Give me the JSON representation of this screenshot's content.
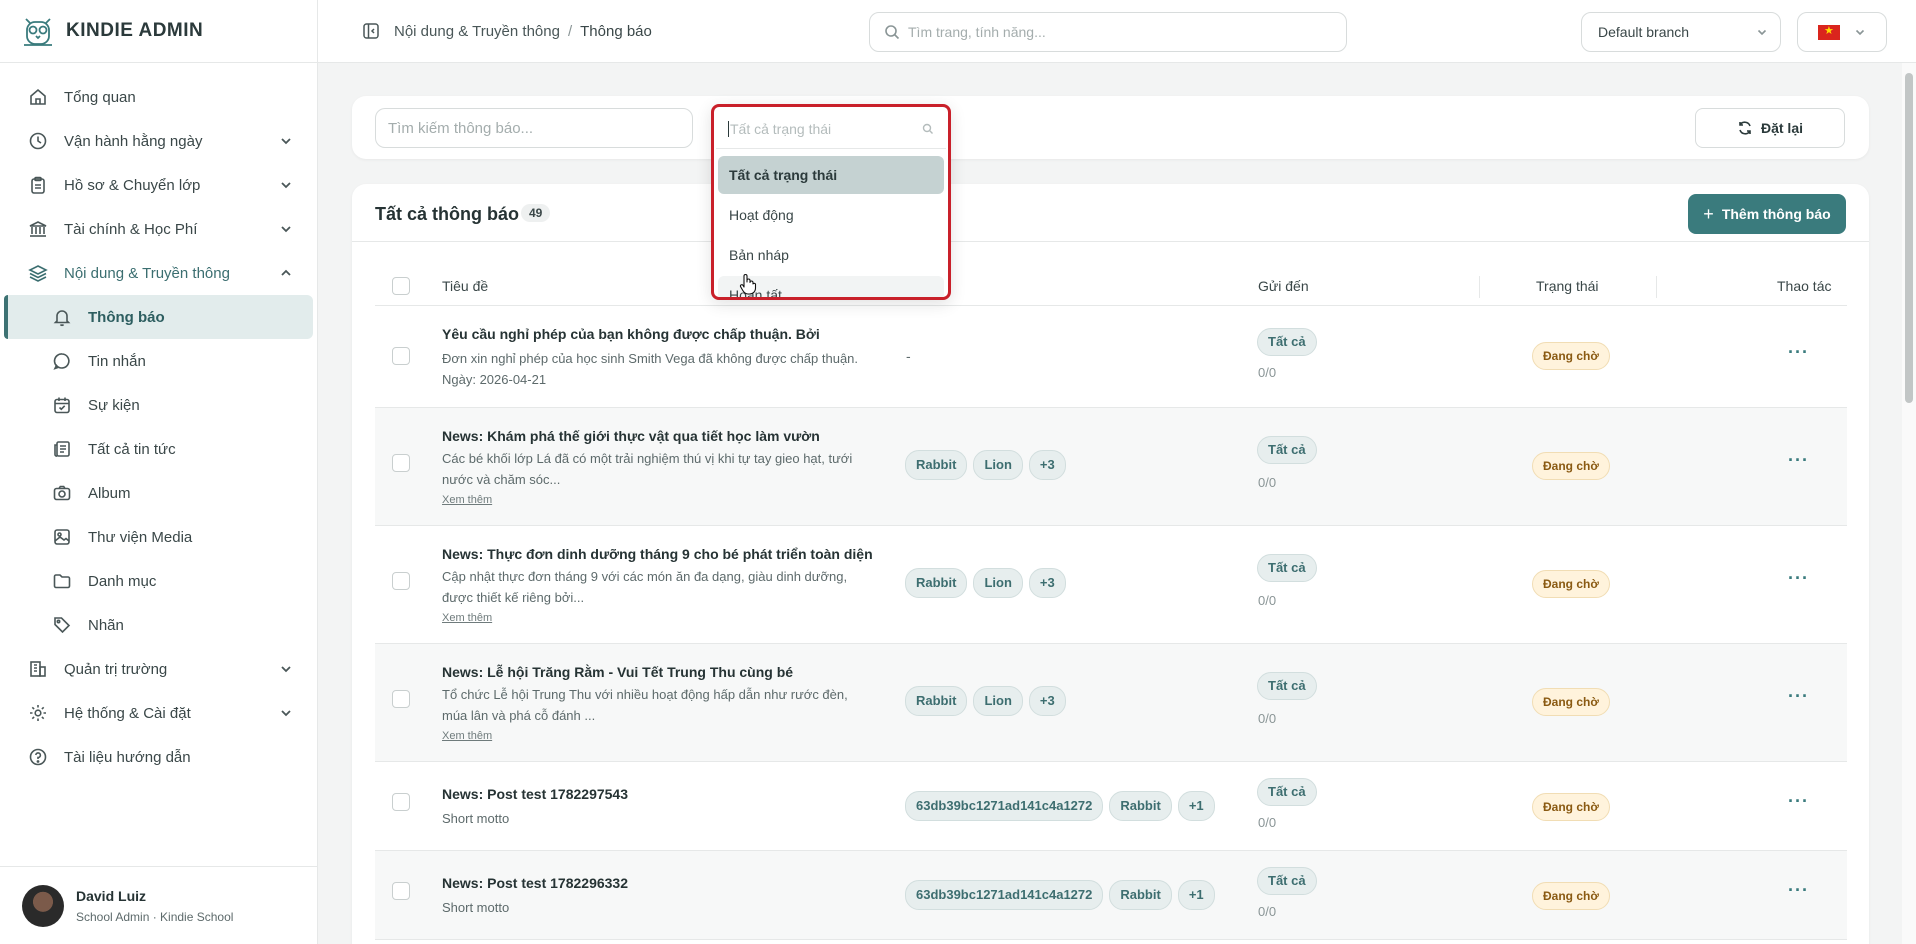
{
  "app": {
    "name": "KINDIE ADMIN"
  },
  "sidebar": {
    "items": [
      {
        "label": "Tổng quan",
        "icon": "home-icon",
        "expandable": false
      },
      {
        "label": "Vận hành hằng ngày",
        "icon": "clock-icon",
        "expandable": true
      },
      {
        "label": "Hồ sơ & Chuyển lớp",
        "icon": "clipboard-icon",
        "expandable": true
      },
      {
        "label": "Tài chính & Học Phí",
        "icon": "bank-icon",
        "expandable": true
      },
      {
        "label": "Nội dung & Truyền thông",
        "icon": "layers-icon",
        "expandable": true,
        "open": true
      }
    ],
    "sub_items": [
      {
        "label": "Thông báo",
        "icon": "bell-icon",
        "active": true
      },
      {
        "label": "Tin nhắn",
        "icon": "message-icon"
      },
      {
        "label": "Sự kiện",
        "icon": "calendar-icon"
      },
      {
        "label": "Tất cả tin tức",
        "icon": "newspaper-icon"
      },
      {
        "label": "Album",
        "icon": "camera-icon"
      },
      {
        "label": "Thư viện Media",
        "icon": "image-icon"
      },
      {
        "label": "Danh mục",
        "icon": "folder-icon"
      },
      {
        "label": "Nhãn",
        "icon": "tag-icon"
      }
    ],
    "bottom_items": [
      {
        "label": "Quản trị trường",
        "icon": "building-icon",
        "expandable": true
      },
      {
        "label": "Hệ thống & Cài đặt",
        "icon": "gear-icon",
        "expandable": true
      },
      {
        "label": "Tài liệu hướng dẫn",
        "icon": "help-icon",
        "expandable": false
      }
    ],
    "user": {
      "name": "David Luiz",
      "role": "School Admin · Kindie School"
    }
  },
  "topbar": {
    "breadcrumb": [
      "Nội dung & Truyền thông",
      "Thông báo"
    ],
    "search_placeholder": "Tìm trang, tính năng...",
    "branch": "Default branch"
  },
  "filters": {
    "search_placeholder": "Tìm kiếm thông báo...",
    "reset_label": "Đặt lại"
  },
  "status_dropdown": {
    "placeholder": "Tất cả trạng thái",
    "options": [
      "Tất cả trạng thái",
      "Hoạt động",
      "Bản nháp",
      "Hoàn tất"
    ],
    "selected_index": 0
  },
  "list": {
    "title": "Tất cả thông báo",
    "count": "49",
    "add_label": "Thêm thông báo",
    "columns": {
      "title": "Tiêu đề",
      "send_to": "Gửi đến",
      "status": "Trạng thái",
      "actions": "Thao tác"
    },
    "rows": [
      {
        "title": "Yêu cầu nghỉ phép của bạn không được chấp thuận. Bởi",
        "desc": "Đơn xin nghỉ phép của học sinh Smith Vega đã không được chấp thuận. Ngày: 2026-04-21",
        "more": "",
        "classes": [],
        "dash": "-",
        "send": "Tất cả",
        "send_count": "0/0",
        "status": "Đang chờ"
      },
      {
        "title": "News: Khám phá thế giới thực vật qua tiết học làm vườn",
        "desc": "Các bé khối lớp Lá đã có một trải nghiệm thú vị khi tự tay gieo hạt, tưới nước và chăm sóc...",
        "more": "Xem thêm",
        "classes": [
          "Rabbit",
          "Lion",
          "+3"
        ],
        "dash": "",
        "send": "Tất cả",
        "send_count": "0/0",
        "status": "Đang chờ"
      },
      {
        "title": "News: Thực đơn dinh dưỡng tháng 9 cho bé phát triển toàn diện",
        "desc": "Cập nhật thực đơn tháng 9 với các món ăn đa dạng, giàu dinh dưỡng, được thiết kế riêng bởi...",
        "more": "Xem thêm",
        "classes": [
          "Rabbit",
          "Lion",
          "+3"
        ],
        "dash": "",
        "send": "Tất cả",
        "send_count": "0/0",
        "status": "Đang chờ"
      },
      {
        "title": "News: Lễ hội Trăng Rằm - Vui Tết Trung Thu cùng bé",
        "desc": "Tổ chức Lễ hội Trung Thu với nhiều hoạt động hấp dẫn như rước đèn, múa lân và phá cỗ đánh ...",
        "more": "Xem thêm",
        "classes": [
          "Rabbit",
          "Lion",
          "+3"
        ],
        "dash": "",
        "send": "Tất cả",
        "send_count": "0/0",
        "status": "Đang chờ"
      },
      {
        "title": "News: Post test 1782297543",
        "desc": "Short motto",
        "more": "",
        "classes": [
          "63db39bc1271ad141c4a1272",
          "Rabbit",
          "+1"
        ],
        "dash": "",
        "send": "Tất cả",
        "send_count": "0/0",
        "status": "Đang chờ"
      },
      {
        "title": "News: Post test 1782296332",
        "desc": "Short motto",
        "more": "",
        "classes": [
          "63db39bc1271ad141c4a1272",
          "Rabbit",
          "+1"
        ],
        "dash": "",
        "send": "Tất cả",
        "send_count": "0/0",
        "status": "Đang chờ"
      }
    ]
  },
  "colors": {
    "accent": "#3a7b7d",
    "highlight_border": "#c9202a",
    "pending_bg": "#fff3dc"
  }
}
